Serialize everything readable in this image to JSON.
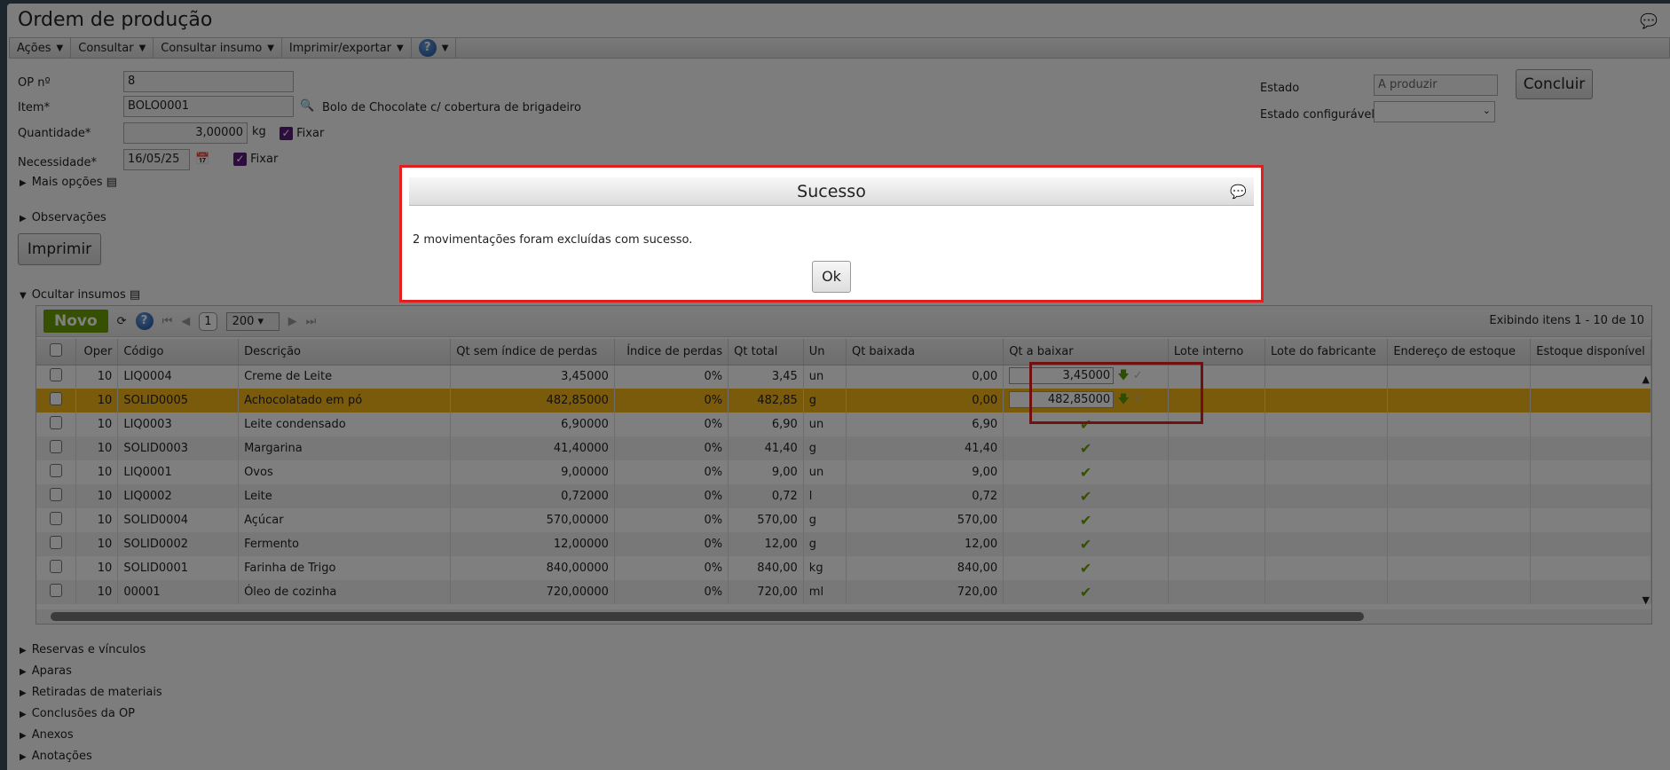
{
  "window": {
    "title": "Ordem de produção"
  },
  "toolbar": {
    "acoes": "Ações",
    "consultar": "Consultar",
    "consultar_insumo": "Consultar insumo",
    "imprimir_exportar": "Imprimir/exportar",
    "help": "?"
  },
  "form": {
    "op_label": "OP nº",
    "op_value": "8",
    "item_label": "Item*",
    "item_value": "BOLO0001",
    "item_desc": "Bolo de Chocolate c/ cobertura de brigadeiro",
    "qtd_label": "Quantidade*",
    "qtd_value": "3,00000",
    "qtd_unit": "kg",
    "fixar": "Fixar",
    "nec_label": "Necessidade*",
    "nec_value": "16/05/25",
    "mais_opcoes": "Mais opções",
    "observacoes": "Observações",
    "imprimir": "Imprimir",
    "estado_label": "Estado",
    "estado_value": "A produzir",
    "estado_conf_label": "Estado configurável",
    "concluir": "Concluir",
    "ocultar_insumos": "Ocultar insumos"
  },
  "grid": {
    "novo": "Novo",
    "page": "1",
    "page_size": "200",
    "info": "Exibindo itens 1 - 10 de 10",
    "columns": [
      "Oper",
      "Código",
      "Descrição",
      "Qt sem índice de perdas",
      "Índice de perdas",
      "Qt total",
      "Un",
      "Qt baixada",
      "Qt a baixar",
      "Lote interno",
      "Lote do fabricante",
      "Endereço de estoque",
      "Estoque disponível"
    ],
    "rows": [
      {
        "oper": "10",
        "codigo": "LIQ0004",
        "desc": "Creme de Leite",
        "qtsem": "3,45000",
        "indice": "0%",
        "qttotal": "3,45",
        "un": "un",
        "baixada": "0,00",
        "abaixar": "3,45000"
      },
      {
        "oper": "10",
        "codigo": "SOLID0005",
        "desc": "Achocolatado em pó",
        "qtsem": "482,85000",
        "indice": "0%",
        "qttotal": "482,85",
        "un": "g",
        "baixada": "0,00",
        "abaixar": "482,85000"
      },
      {
        "oper": "10",
        "codigo": "LIQ0003",
        "desc": "Leite condensado",
        "qtsem": "6,90000",
        "indice": "0%",
        "qttotal": "6,90",
        "un": "un",
        "baixada": "6,90",
        "abaixar": ""
      },
      {
        "oper": "10",
        "codigo": "SOLID0003",
        "desc": "Margarina",
        "qtsem": "41,40000",
        "indice": "0%",
        "qttotal": "41,40",
        "un": "g",
        "baixada": "41,40",
        "abaixar": ""
      },
      {
        "oper": "10",
        "codigo": "LIQ0001",
        "desc": "Ovos",
        "qtsem": "9,00000",
        "indice": "0%",
        "qttotal": "9,00",
        "un": "un",
        "baixada": "9,00",
        "abaixar": ""
      },
      {
        "oper": "10",
        "codigo": "LIQ0002",
        "desc": "Leite",
        "qtsem": "0,72000",
        "indice": "0%",
        "qttotal": "0,72",
        "un": "l",
        "baixada": "0,72",
        "abaixar": ""
      },
      {
        "oper": "10",
        "codigo": "SOLID0004",
        "desc": "Açúcar",
        "qtsem": "570,00000",
        "indice": "0%",
        "qttotal": "570,00",
        "un": "g",
        "baixada": "570,00",
        "abaixar": ""
      },
      {
        "oper": "10",
        "codigo": "SOLID0002",
        "desc": "Fermento",
        "qtsem": "12,00000",
        "indice": "0%",
        "qttotal": "12,00",
        "un": "g",
        "baixada": "12,00",
        "abaixar": ""
      },
      {
        "oper": "10",
        "codigo": "SOLID0001",
        "desc": "Farinha de Trigo",
        "qtsem": "840,00000",
        "indice": "0%",
        "qttotal": "840,00",
        "un": "kg",
        "baixada": "840,00",
        "abaixar": ""
      },
      {
        "oper": "10",
        "codigo": "00001",
        "desc": "Óleo de cozinha",
        "qtsem": "720,00000",
        "indice": "0%",
        "qttotal": "720,00",
        "un": "ml",
        "baixada": "720,00",
        "abaixar": ""
      }
    ]
  },
  "sections": [
    "Reservas e vínculos",
    "Aparas",
    "Retiradas de materiais",
    "Conclusões da OP",
    "Anexos",
    "Anotações"
  ],
  "modal": {
    "title": "Sucesso",
    "message": "2 movimentações foram excluídas com sucesso.",
    "ok": "Ok"
  }
}
